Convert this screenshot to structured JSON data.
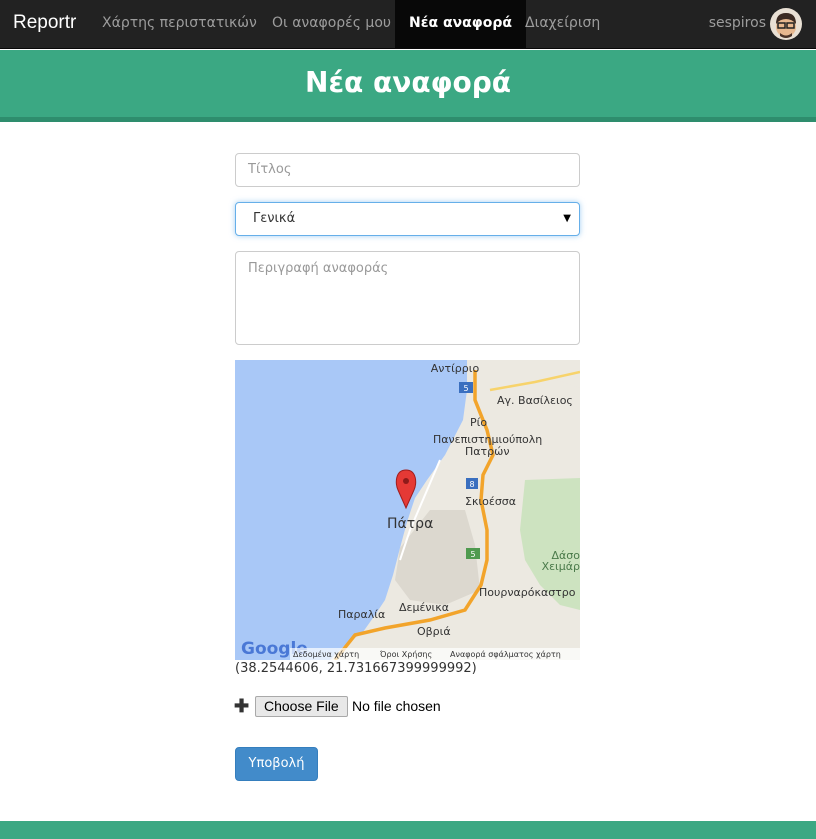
{
  "navbar": {
    "brand": "Reportr",
    "items": [
      {
        "label": "Χάρτης περιστατικών"
      },
      {
        "label": "Οι αναφορές μου"
      },
      {
        "label": "Νέα αναφορά"
      },
      {
        "label": "Διαχείριση"
      }
    ],
    "username": "sespiros"
  },
  "banner": {
    "title": "Νέα αναφορά"
  },
  "form": {
    "title_placeholder": "Τίτλος",
    "category_selected": "Γενικά",
    "description_placeholder": "Περιγραφή αναφοράς",
    "coordinates": "(38.2544606, 21.731667399999992)",
    "file_button": "Choose File",
    "file_status": "No file chosen",
    "submit_label": "Υποβολή"
  },
  "map": {
    "labels": {
      "antirrio": "Αντίρριο",
      "ag_vasileios": "Αγ. Βασίλειος",
      "rio": "Ρίο",
      "university_1": "Πανεπιστημιούπολη",
      "university_2": "Πατρών",
      "skioessa": "Σκιοέσσα",
      "patra": "Πάτρα",
      "dasos_1": "Δάσο",
      "dasos_2": "Χειμάρ",
      "pournarokastro": "Πουρναρόκαστρο",
      "paralia": "Παραλία",
      "demenika": "Δεμένικα",
      "ovria": "Οβριά",
      "road_5a": "5",
      "road_8": "8",
      "road_5b": "5",
      "google": "Google",
      "map_data": "Δεδομένα χάρτη",
      "terms": "Όροι Χρήσης",
      "report_error": "Αναφορά σφάλματος χάρτη"
    }
  },
  "colors": {
    "navbar_bg": "#222222",
    "banner_bg": "#3ba883",
    "submit_bg": "#428bca",
    "sea": "#a9c8f7",
    "land": "#ece9e1",
    "motorway": "#f2a42b"
  }
}
